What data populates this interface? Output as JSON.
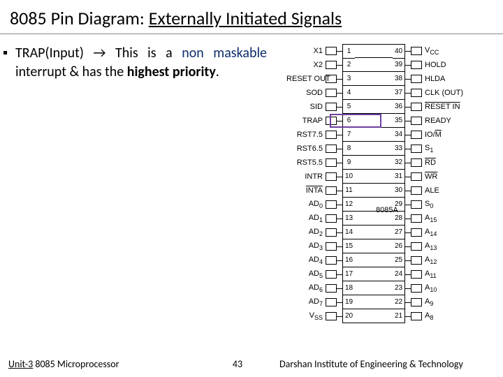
{
  "title": {
    "pre": "8085 Pin Diagram: ",
    "ul": "Externally Initiated Signals"
  },
  "bullet": {
    "lead": "TRAP(Input) ",
    "arrow": "→",
    "mid1": " This is a ",
    "nm": "non maskable",
    "mid2": " interrupt & has the ",
    "hp": "highest priority",
    "end": "."
  },
  "chip_label": "8085A",
  "pins": [
    {
      "l": "X1",
      "ln": "1",
      "rn": "40",
      "r": "V",
      "rsub": "CC"
    },
    {
      "l": "X2",
      "ln": "2",
      "rn": "39",
      "r": "HOLD"
    },
    {
      "l": "RESET OUT",
      "ln": "3",
      "rn": "38",
      "r": "HLDA"
    },
    {
      "l": "SOD",
      "ln": "4",
      "rn": "37",
      "r": "CLK (OUT)"
    },
    {
      "l": "SID",
      "ln": "5",
      "rn": "36",
      "r": "RESET IN",
      "rov": true
    },
    {
      "l": "TRAP",
      "ln": "6",
      "rn": "35",
      "r": "READY"
    },
    {
      "l": "RST7.5",
      "ln": "7",
      "rn": "34",
      "r": "IO/M",
      "rpart": "M"
    },
    {
      "l": "RST6.5",
      "ln": "8",
      "rn": "33",
      "r": "S",
      "rsub": "1"
    },
    {
      "l": "RST5.5",
      "ln": "9",
      "rn": "32",
      "r": "RD",
      "rov": true
    },
    {
      "l": "INTR",
      "ln": "10",
      "rn": "31",
      "r": "WR",
      "rov": true
    },
    {
      "l": "INTA",
      "lov": true,
      "ln": "11",
      "rn": "30",
      "r": "ALE"
    },
    {
      "l": "AD",
      "lsub": "0",
      "ln": "12",
      "rn": "29",
      "r": "S",
      "rsub": "0"
    },
    {
      "l": "AD",
      "lsub": "1",
      "ln": "13",
      "rn": "28",
      "r": "A",
      "rsub": "15"
    },
    {
      "l": "AD",
      "lsub": "2",
      "ln": "14",
      "rn": "27",
      "r": "A",
      "rsub": "14"
    },
    {
      "l": "AD",
      "lsub": "3",
      "ln": "15",
      "rn": "26",
      "r": "A",
      "rsub": "13"
    },
    {
      "l": "AD",
      "lsub": "4",
      "ln": "16",
      "rn": "25",
      "r": "A",
      "rsub": "12"
    },
    {
      "l": "AD",
      "lsub": "5",
      "ln": "17",
      "rn": "24",
      "r": "A",
      "rsub": "11"
    },
    {
      "l": "AD",
      "lsub": "6",
      "ln": "18",
      "rn": "23",
      "r": "A",
      "rsub": "10"
    },
    {
      "l": "AD",
      "lsub": "7",
      "ln": "19",
      "rn": "22",
      "r": "A",
      "rsub": "9"
    },
    {
      "l": "V",
      "lsub": "SS",
      "ln": "20",
      "rn": "21",
      "r": "A",
      "rsub": "8"
    }
  ],
  "footer": {
    "left_a": "Unit-3",
    "left_b": " 8085 Microprocessor",
    "page": "43",
    "right": "Darshan Institute of Engineering & Technology"
  }
}
